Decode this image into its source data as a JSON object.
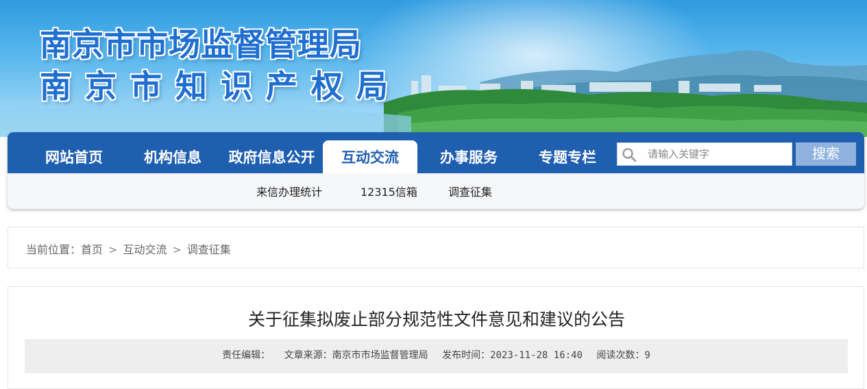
{
  "banner": {
    "title_line1": "南京市市场监督管理局",
    "title_line2": "南京市知识产权局"
  },
  "nav": {
    "items": [
      {
        "label": "网站首页"
      },
      {
        "label": "机构信息"
      },
      {
        "label": "政府信息公开"
      },
      {
        "label": "互动交流",
        "active": true
      },
      {
        "label": "办事服务"
      },
      {
        "label": "专题专栏"
      }
    ],
    "search": {
      "placeholder": "请输入关键字",
      "button_label": "搜索"
    },
    "subnav": [
      {
        "label": "来信办理统计"
      },
      {
        "label": "12315信箱"
      },
      {
        "label": "调查征集"
      }
    ]
  },
  "breadcrumb": {
    "prefix": "当前位置：",
    "items": [
      "首页",
      "互动交流",
      "调查征集"
    ],
    "separator": ">"
  },
  "article": {
    "title": "关于征集拟废止部分规范性文件意见和建议的公告",
    "meta": {
      "editor_label": "责任编辑：",
      "editor_value": "",
      "source_label": "文章来源：",
      "source_value": "南京市市场监督管理局",
      "published_label": "发布时间：",
      "published_value": "2023-11-28 16:40",
      "views_label": "阅读次数：",
      "views_value": "9"
    }
  },
  "colors": {
    "nav_blue": "#1f5fb0",
    "title_blue": "#1f6fd0",
    "search_button": "#8fb3dd"
  }
}
